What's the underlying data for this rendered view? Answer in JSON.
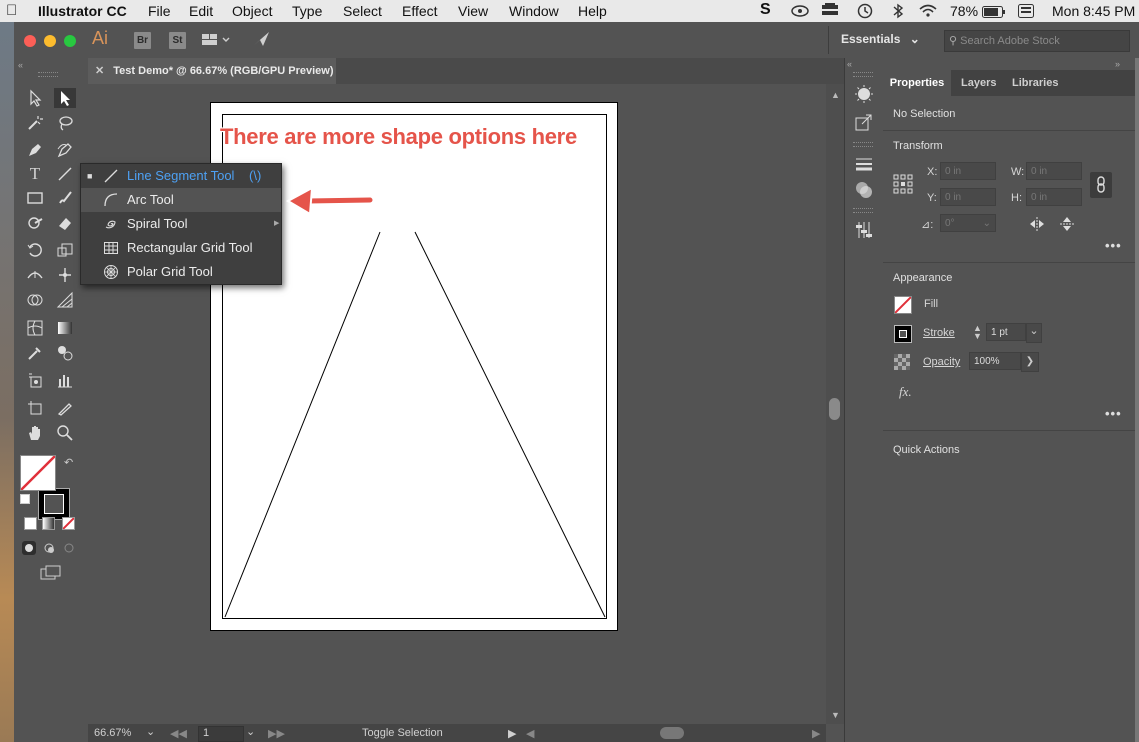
{
  "menubar": {
    "app_name": "Illustrator CC",
    "items": [
      "File",
      "Edit",
      "Object",
      "Type",
      "Select",
      "Effect",
      "View",
      "Window",
      "Help"
    ],
    "battery": "78%",
    "clock": "Mon 8:45 PM"
  },
  "appbar": {
    "app_icon": "Ai",
    "bridge_label": "Br",
    "stock_label": "St",
    "workspace": "Essentials",
    "search_placeholder": "Search Adobe Stock"
  },
  "document_tab": {
    "title": "Test Demo* @ 66.67% (RGB/GPU Preview)"
  },
  "flyout_menu": {
    "items": [
      {
        "label": "Line Segment Tool",
        "shortcut": "(\\)",
        "selected": true,
        "icon": "line-segment-icon"
      },
      {
        "label": "Arc Tool",
        "shortcut": "",
        "selected": false,
        "icon": "arc-icon"
      },
      {
        "label": "Spiral Tool",
        "shortcut": "",
        "selected": false,
        "icon": "spiral-icon"
      },
      {
        "label": "Rectangular Grid Tool",
        "shortcut": "",
        "selected": false,
        "icon": "rect-grid-icon"
      },
      {
        "label": "Polar Grid Tool",
        "shortcut": "",
        "selected": false,
        "icon": "polar-grid-icon"
      }
    ],
    "highlight_color": "#4ea1f3"
  },
  "annotation": {
    "text": "There are more shape options here",
    "color": "#e5544a"
  },
  "statusbar": {
    "zoom": "66.67%",
    "artboard_number": "1",
    "status_text": "Toggle Selection"
  },
  "properties_panel": {
    "tabs": [
      "Properties",
      "Layers",
      "Libraries"
    ],
    "selection_status": "No Selection",
    "transform": {
      "title": "Transform",
      "x_label": "X:",
      "x_value": "0 in",
      "y_label": "Y:",
      "y_value": "0 in",
      "w_label": "W:",
      "w_value": "0 in",
      "h_label": "H:",
      "h_value": "0 in",
      "angle_label": "⊿:",
      "angle_value": "0°"
    },
    "appearance": {
      "title": "Appearance",
      "fill_label": "Fill",
      "stroke_label": "Stroke",
      "stroke_value": "1 pt",
      "opacity_label": "Opacity",
      "opacity_value": "100%",
      "fx_label": "fx."
    },
    "quick_actions": {
      "title": "Quick Actions"
    }
  },
  "colors": {
    "ui_bg": "#535353",
    "accent": "#4ea1f3",
    "annotation_red": "#e5544a"
  }
}
